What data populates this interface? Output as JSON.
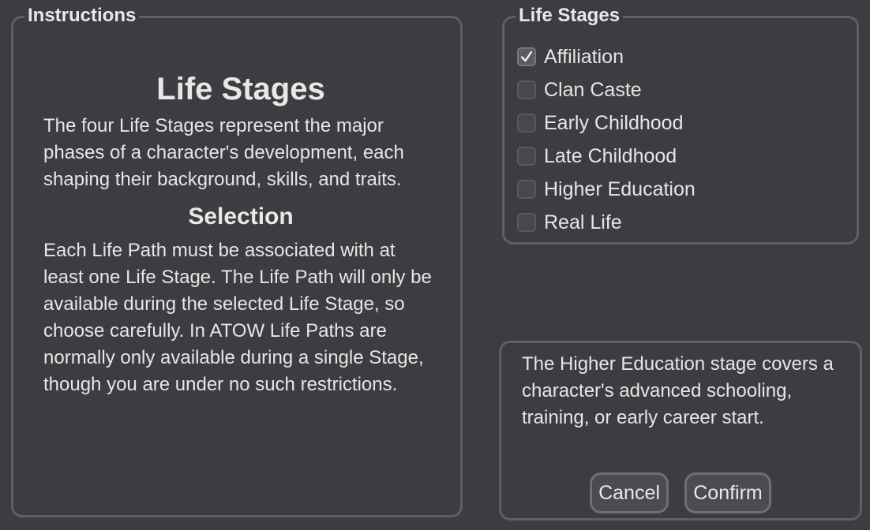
{
  "instructions": {
    "title": "Instructions",
    "heading": "Life Stages",
    "intro": "The four Life Stages represent the major phases of a character's development, each shaping their background, skills, and traits.",
    "subheading": "Selection",
    "body": "Each Life Path must be associated with at least one Life Stage. The Life Path will only be available during the selected Life Stage, so choose carefully. In ATOW Life Paths are normally only available during a single Stage, though you are under no such restrictions."
  },
  "stages": {
    "title": "Life Stages",
    "items": [
      {
        "label": "Affiliation",
        "checked": true
      },
      {
        "label": "Clan Caste",
        "checked": false
      },
      {
        "label": "Early Childhood",
        "checked": false
      },
      {
        "label": "Late Childhood",
        "checked": false
      },
      {
        "label": "Higher Education",
        "checked": false
      },
      {
        "label": "Real Life",
        "checked": false
      }
    ]
  },
  "description": {
    "text": "The Higher Education stage covers a character's advanced schooling, training, or early career start."
  },
  "buttons": {
    "cancel": "Cancel",
    "confirm": "Confirm"
  },
  "colors": {
    "background": "#3b3d40",
    "border": "#5d6064",
    "text": "#e6e6e6"
  },
  "icons": {
    "checked": "checkmark-icon"
  }
}
